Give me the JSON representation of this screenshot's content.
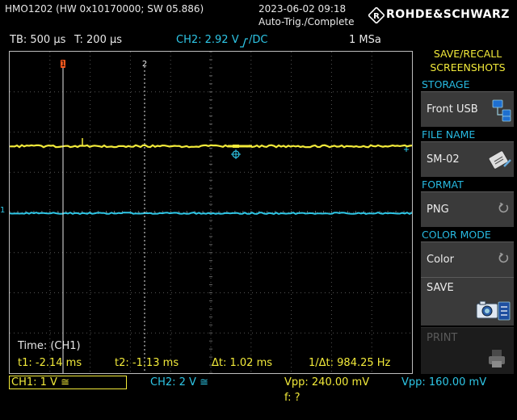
{
  "header": {
    "device": "HMO1202 (HW 0x10170000; SW 05.886)",
    "datetime": "2023-06-02 09:18",
    "trigger_status": "Auto-Trig./Complete",
    "brand": "ROHDE&SCHWARZ"
  },
  "status_bar": {
    "timebase": "TB: 500 µs",
    "trigger_time": "T: 200 µs",
    "trigger_level": "CH2: 2.92 V",
    "trigger_coupling": "DC",
    "sample_rate": "1 MSa"
  },
  "screen": {
    "cursor1_label": "1",
    "cursor2_label": "2",
    "ch2_marker": "1"
  },
  "measurements": {
    "title": "Time: (CH1)",
    "t1": "t1: -2.14 ms",
    "t2": "t2: -1.13 ms",
    "dt": "Δt: 1.02 ms",
    "inv_dt": "1/Δt: 984.25 Hz"
  },
  "channels": {
    "ch1": "CH1: 1 V",
    "ch2": "CH2: 2 V",
    "vpp1": "Vpp: 240.00 mV",
    "vpp2": "Vpp: 160.00 mV",
    "freq": "f: ?"
  },
  "menu": {
    "title_line1": "SAVE/RECALL",
    "title_line2": "SCREENSHOTS",
    "storage_label": "STORAGE",
    "storage_value": "Front USB",
    "file_name_label": "FILE NAME",
    "file_name_value": "SM-02",
    "format_label": "FORMAT",
    "format_value": "PNG",
    "color_mode_label": "COLOR MODE",
    "color_mode_value": "Color",
    "save_label": "SAVE",
    "print_label": "PRINT"
  },
  "colors": {
    "ch1": "#f2ea3a",
    "ch2": "#2ec6e6",
    "cursor": "#ff5a1e",
    "menu_label": "#27b9e0"
  }
}
